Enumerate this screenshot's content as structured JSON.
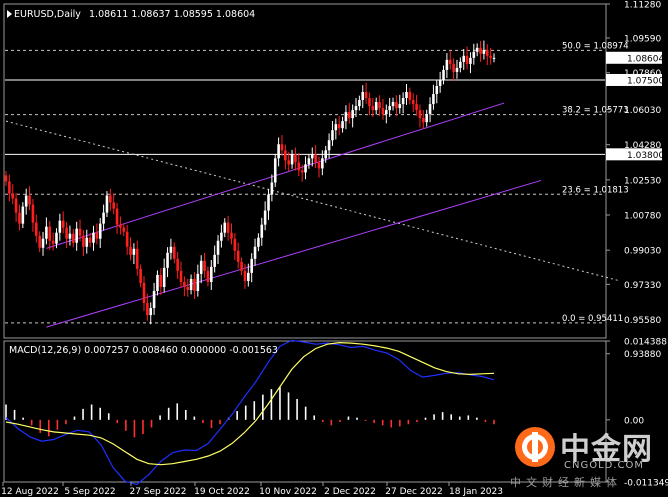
{
  "header": {
    "symbol": "EURUSD,Daily",
    "ohlc": "1.08611 1.08637 1.08595 1.08604"
  },
  "macd_header": "MACD(12,26,9) 0.007257 0.008460 0.000000 -0.001563",
  "colors": {
    "background": "#000000",
    "up_candle": "#ffffff",
    "down_candle": "#ff1f1f",
    "macd_line": "#1f2fff",
    "signal_line": "#ffff66",
    "channel": "#b040ff",
    "hist_up": "#ffffff",
    "hist_down": "#ff3030",
    "fib": "#c8c8c8",
    "level_line": "#ffffff",
    "level_box": "#ffffff"
  },
  "watermark": {
    "brand": "中金网",
    "domain": "CNGOLD.COM",
    "tagline": "中文财经新媒体"
  },
  "chart_data": [
    {
      "type": "candlestick",
      "title": "EURUSD,Daily",
      "ylim": [
        0.9466,
        1.1128
      ],
      "yticks": [
        "1.11280",
        "1.09590",
        "1.07860",
        "1.06030",
        "1.04280",
        "1.02530",
        "1.00780",
        "0.99030",
        "0.97330",
        "0.95580",
        "0.93880"
      ],
      "xlabels": [
        "12 Aug 2022",
        "5 Sep 2022",
        "27 Sep 2022",
        "19 Oct 2022",
        "10 Nov 2022",
        "2 Dec 2022",
        "27 Dec 2022",
        "18 Jan 2023"
      ],
      "current_price": "1.08604",
      "fib_levels": [
        {
          "label": "0.0 = 0.95411",
          "value": 0.95411
        },
        {
          "label": "23.6 = 1.01813",
          "value": 1.01813
        },
        {
          "label": "38.2 = 1.05773",
          "value": 1.05773
        },
        {
          "label": "50.0 = 1.08974",
          "value": 1.08974
        }
      ],
      "horizontal_levels": [
        {
          "label": "1.07500",
          "value": 1.075
        },
        {
          "label": "1.03800",
          "value": 1.038
        }
      ],
      "channel_lines": [
        {
          "from": [
            12,
            0.9912
          ],
          "to": [
            148,
            1.0635
          ]
        },
        {
          "from": [
            12,
            0.952
          ],
          "to": [
            159,
            1.025
          ]
        }
      ],
      "trendline_dotted": {
        "from": [
          0,
          1.0545
        ],
        "to": [
          198,
          0.975
        ]
      },
      "candles_close": [
        1.0245,
        1.0185,
        1.016,
        1.009,
        1.0035,
        1.012,
        1.0175,
        1.013,
        1.004,
        0.9975,
        0.9915,
        0.996,
        1.002,
        0.995,
        0.9935,
        0.999,
        1.005,
        1.0015,
        0.996,
        0.9985,
        0.994,
        1.001,
        0.9975,
        0.992,
        0.9965,
        0.994,
        0.999,
        0.996,
        1.0035,
        1.009,
        1.0175,
        1.014,
        1.011,
        1.003,
        1.0015,
        0.9995,
        0.992,
        0.988,
        0.991,
        0.981,
        0.974,
        0.964,
        0.958,
        0.9615,
        0.97,
        0.978,
        0.972,
        0.9815,
        0.989,
        0.992,
        0.986,
        0.98,
        0.9745,
        0.972,
        0.9705,
        0.976,
        0.97,
        0.9785,
        0.985,
        0.98,
        0.9745,
        0.982,
        0.988,
        0.995,
        0.999,
        1.004,
        0.999,
        0.996,
        0.99,
        0.9845,
        0.98,
        0.975,
        0.979,
        0.986,
        0.992,
        0.9965,
        1.003,
        1.01,
        1.018,
        1.024,
        1.036,
        1.043,
        1.04,
        1.035,
        1.033,
        1.038,
        1.034,
        1.03,
        1.029,
        1.033,
        1.036,
        1.038,
        1.034,
        1.031,
        1.036,
        1.04,
        1.045,
        1.05,
        1.053,
        1.051,
        1.0545,
        1.059,
        1.056,
        1.06,
        1.062,
        1.065,
        1.069,
        1.066,
        1.062,
        1.06,
        1.064,
        1.061,
        1.058,
        1.06,
        1.062,
        1.064,
        1.061,
        1.063,
        1.066,
        1.069,
        1.065,
        1.063,
        1.06,
        1.056,
        1.054,
        1.058,
        1.063,
        1.068,
        1.072,
        1.075,
        1.08,
        1.085,
        1.083,
        1.079,
        1.081,
        1.084,
        1.087,
        1.083,
        1.086,
        1.089,
        1.091,
        1.088,
        1.09,
        1.087,
        1.086,
        1.086
      ],
      "macd_panel": {
        "yticks": [
          "0.014388",
          "0.00",
          "-0.011349"
        ],
        "macd_line": [
          0.0004,
          -0.0016,
          -0.0031,
          -0.0039,
          -0.0036,
          -0.0027,
          -0.0019,
          -0.0022,
          -0.0046,
          -0.0087,
          -0.0112,
          -0.0118,
          -0.01,
          -0.0076,
          -0.006,
          -0.0055,
          -0.0056,
          -0.0043,
          -0.0017,
          0.001,
          0.0041,
          0.007,
          0.0104,
          0.0134,
          0.0145,
          0.0142,
          0.0138,
          0.014,
          0.0137,
          0.0132,
          0.0134,
          0.0127,
          0.0122,
          0.011,
          0.009,
          0.0078,
          0.0081,
          0.0085,
          0.0086,
          0.0082,
          0.0079,
          0.0073
        ],
        "signal_line": [
          -0.0004,
          -0.0008,
          -0.0013,
          -0.0018,
          -0.0022,
          -0.0024,
          -0.0026,
          -0.0028,
          -0.0033,
          -0.0044,
          -0.0058,
          -0.0072,
          -0.008,
          -0.0082,
          -0.008,
          -0.0076,
          -0.0072,
          -0.0066,
          -0.0057,
          -0.0043,
          -0.0024,
          -0.0001,
          0.0028,
          0.006,
          0.0092,
          0.0115,
          0.013,
          0.0138,
          0.0141,
          0.014,
          0.0138,
          0.0135,
          0.0131,
          0.0125,
          0.0115,
          0.0105,
          0.0095,
          0.0088,
          0.0084,
          0.0083,
          0.0084,
          0.0085
        ],
        "histogram": [
          0.0028,
          0.0018,
          0.0004,
          -0.001,
          -0.0024,
          -0.003,
          -0.0018,
          -0.0008,
          0.0006,
          0.002,
          0.0028,
          0.0022,
          0.0012,
          -0.0006,
          -0.002,
          -0.0032,
          -0.0026,
          -0.0014,
          0.0008,
          0.0022,
          0.003,
          0.0018,
          0.0006,
          -0.0006,
          -0.0015,
          -0.0008,
          0.0004,
          0.0016,
          0.0026,
          0.0034,
          0.0046,
          0.0056,
          0.006,
          0.005,
          0.0038,
          0.0024,
          0.0008,
          -0.0004,
          -0.001,
          -0.0004,
          0.0006,
          0.0004,
          -0.0002,
          -0.0006,
          -0.001,
          -0.0014,
          -0.0012,
          -0.0008,
          -0.0004,
          0.0004,
          0.001,
          0.0014,
          0.001,
          0.0006,
          0.0008,
          0.0004,
          -0.0004,
          -0.0008
        ]
      }
    }
  ]
}
